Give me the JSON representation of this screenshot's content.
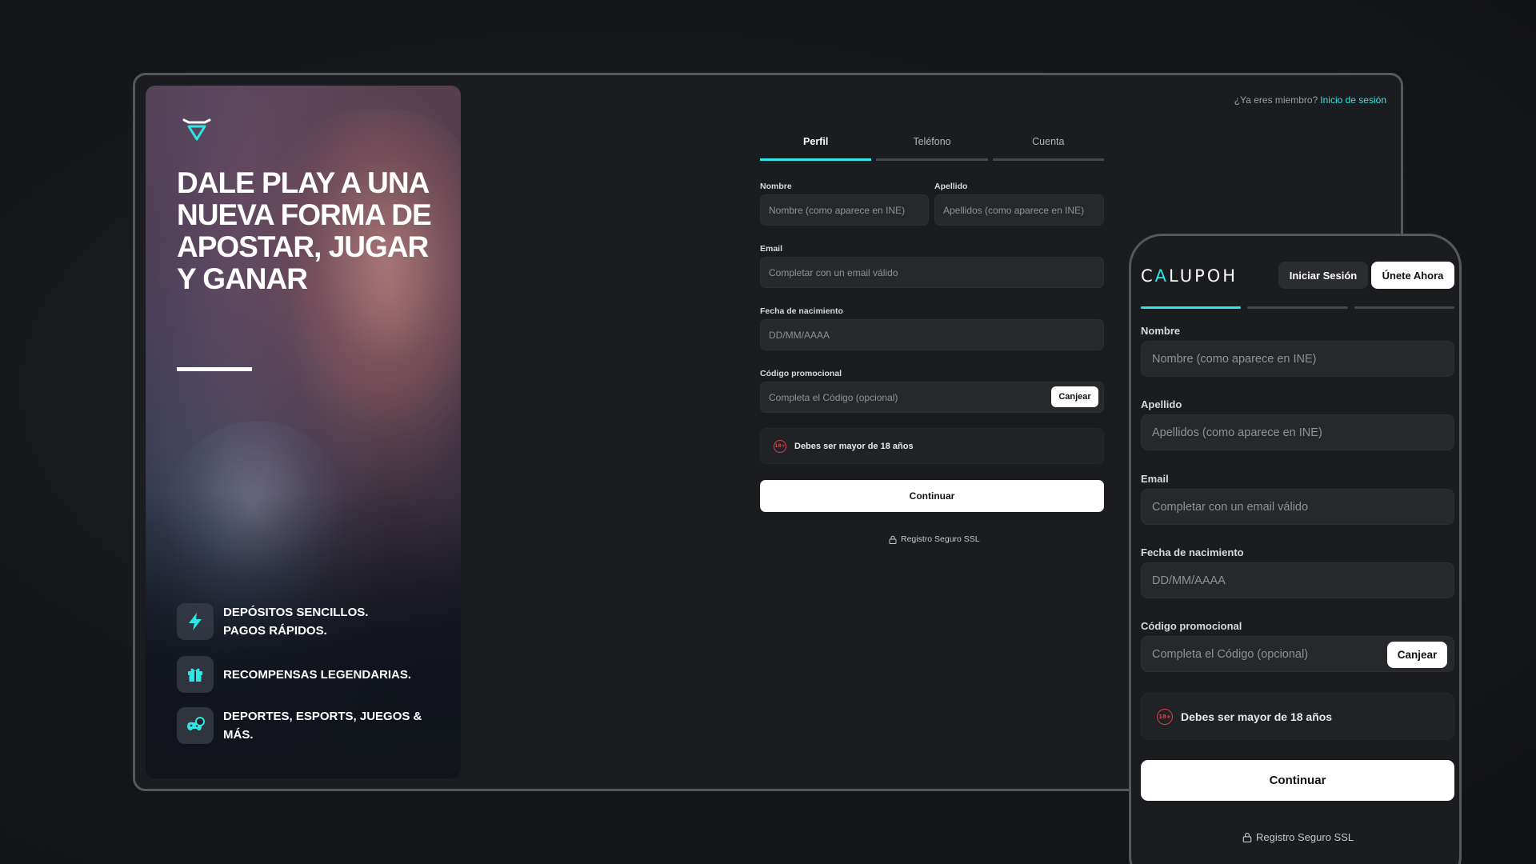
{
  "hero": {
    "logo_icon": "v-shield-logo-icon",
    "title": "DALE PLAY A UNA NUEVA FORMA DE APOSTAR, JUGAR Y GANAR",
    "features": [
      {
        "icon": "lightning-icon",
        "line1": "DEPÓSITOS SENCILLOS.",
        "line2": "PAGOS RÁPIDOS."
      },
      {
        "icon": "gift-icon",
        "line1": "RECOMPENSAS LEGENDARIAS.",
        "line2": ""
      },
      {
        "icon": "gamepad-ball-icon",
        "line1": "DEPORTES, ESPORTS, JUEGOS &",
        "line2": "MÁS."
      }
    ]
  },
  "header": {
    "member_question": "¿Ya eres miembro?",
    "login_link": "Inicio de sesión"
  },
  "tabs": [
    "Perfil",
    "Teléfono",
    "Cuenta"
  ],
  "form": {
    "nombre_label": "Nombre",
    "nombre_placeholder": "Nombre (como aparece en INE)",
    "apellido_label": "Apellido",
    "apellido_placeholder": "Apellidos (como aparece en INE)",
    "email_label": "Email",
    "email_placeholder": "Completar con un email válido",
    "fecha_label": "Fecha de nacimiento",
    "fecha_placeholder": "DD/MM/AAAA",
    "codigo_label": "Código promocional",
    "codigo_placeholder": "Completa el Código (opcional)",
    "canjear": "Canjear",
    "age_badge": "18+",
    "age_notice": "Debes ser mayor de 18 años",
    "continue": "Continuar",
    "ssl": "Registro Seguro SSL"
  },
  "mobile": {
    "logo_a": "C",
    "logo_accent": "A",
    "logo_b": "LUPOH",
    "login_button": "Iniciar Sesión",
    "join_button": "Únete Ahora"
  },
  "colors": {
    "accent": "#2ee6e6",
    "danger": "#e0404a",
    "background": "#15171a"
  }
}
